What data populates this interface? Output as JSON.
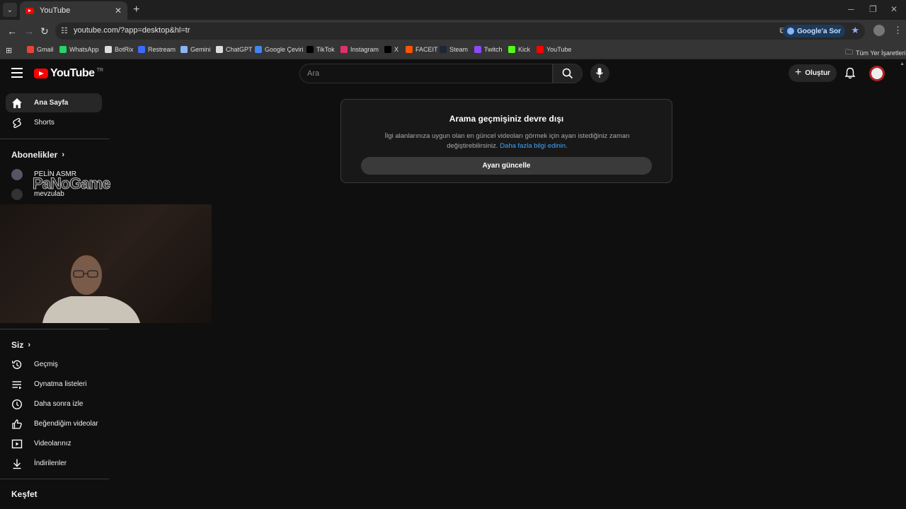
{
  "browser": {
    "tab_title": "YouTube",
    "url": "youtube.com/?app=desktop&hl=tr",
    "ask_google": "Google'a Sor",
    "bookmarks": [
      {
        "label": "Gmail",
        "color": "#ea4335"
      },
      {
        "label": "WhatsApp",
        "color": "#25d366"
      },
      {
        "label": "BotRix",
        "color": "#dddddd"
      },
      {
        "label": "Restream",
        "color": "#3d6bff"
      },
      {
        "label": "Gemini",
        "color": "#8ab4f8"
      },
      {
        "label": "ChatGPT",
        "color": "#dddddd"
      },
      {
        "label": "Google Çeviri",
        "color": "#4285f4"
      },
      {
        "label": "TikTok",
        "color": "#000000"
      },
      {
        "label": "Instagram",
        "color": "#e1306c"
      },
      {
        "label": "X",
        "color": "#000000"
      },
      {
        "label": "FACEIT",
        "color": "#ff5500"
      },
      {
        "label": "Steam",
        "color": "#1b2838"
      },
      {
        "label": "Twitch",
        "color": "#9146ff"
      },
      {
        "label": "Kick",
        "color": "#53fc18"
      },
      {
        "label": "YouTube",
        "color": "#ff0000"
      }
    ],
    "all_bookmarks": "Tüm Yer İşaretleri"
  },
  "youtube": {
    "logo_text": "YouTube",
    "region": "TR",
    "search_placeholder": "Ara",
    "create_label": "Oluştur"
  },
  "sidebar": {
    "home": "Ana Sayfa",
    "shorts": "Shorts",
    "subscriptions_header": "Abonelikler",
    "subscriptions": [
      "PELİN ASMR",
      "mevzulab"
    ],
    "you_header": "Siz",
    "you_items": [
      "Geçmiş",
      "Oynatma listeleri",
      "Daha sonra izle",
      "Beğendiğim videolar",
      "Videolarınız",
      "İndirilenler"
    ],
    "explore_header": "Keşfet"
  },
  "notice": {
    "title": "Arama geçmişiniz devre dışı",
    "body": "İlgi alanlarınıza uygun olan en güncel videoları görmek için ayarı istediğiniz zaman değiştirebilirsiniz.",
    "link": "Daha fazla bilgi edinin.",
    "button": "Ayarı güncelle"
  },
  "overlay": {
    "watermark": "PaNoGame"
  }
}
